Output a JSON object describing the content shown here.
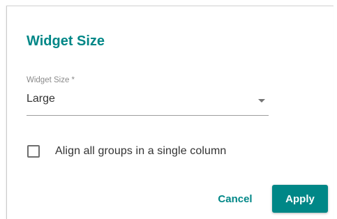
{
  "dialog": {
    "title": "Widget Size",
    "select": {
      "label": "Widget Size *",
      "value": "Large"
    },
    "checkbox": {
      "label": "Align all groups in a single column",
      "checked": false
    },
    "buttons": {
      "cancel": "Cancel",
      "apply": "Apply"
    }
  },
  "colors": {
    "accent": "#008787",
    "text": "#333333",
    "label": "#8a8a8a"
  },
  "icons": {
    "select_caret": "caret-down-icon"
  }
}
